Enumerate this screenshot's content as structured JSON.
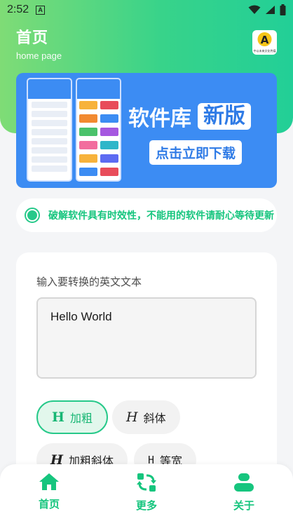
{
  "status_bar": {
    "time": "2:52",
    "app_indicator": "A"
  },
  "header": {
    "title": "首页",
    "subtitle": "home page",
    "logo_letter": "A",
    "logo_caption": "中以未来文化传媒"
  },
  "banner": {
    "title": "软件库",
    "tag": "新版",
    "cta": "点击立即下载"
  },
  "notice": {
    "text": "破解软件具有时效性，不能用的软件请耐心等待更新"
  },
  "converter": {
    "label": "输入要转换的英文文本",
    "input_value": "Hello World",
    "styles": [
      {
        "glyph": "H",
        "label": "加粗",
        "active": true
      },
      {
        "glyph": "H",
        "label": "斜体",
        "active": false
      },
      {
        "glyph": "H",
        "label": "加粗斜体",
        "active": false
      },
      {
        "glyph": "H",
        "label": "等宽",
        "active": false
      }
    ]
  },
  "bottom_nav": [
    {
      "label": "首页",
      "icon": "home-icon"
    },
    {
      "label": "更多",
      "icon": "refresh-grid-icon"
    },
    {
      "label": "关于",
      "icon": "user-icon"
    }
  ],
  "colors": {
    "accent": "#16c57e",
    "hero_start": "#7fdc76",
    "hero_end": "#22cf97",
    "banner": "#3c8cf3"
  }
}
